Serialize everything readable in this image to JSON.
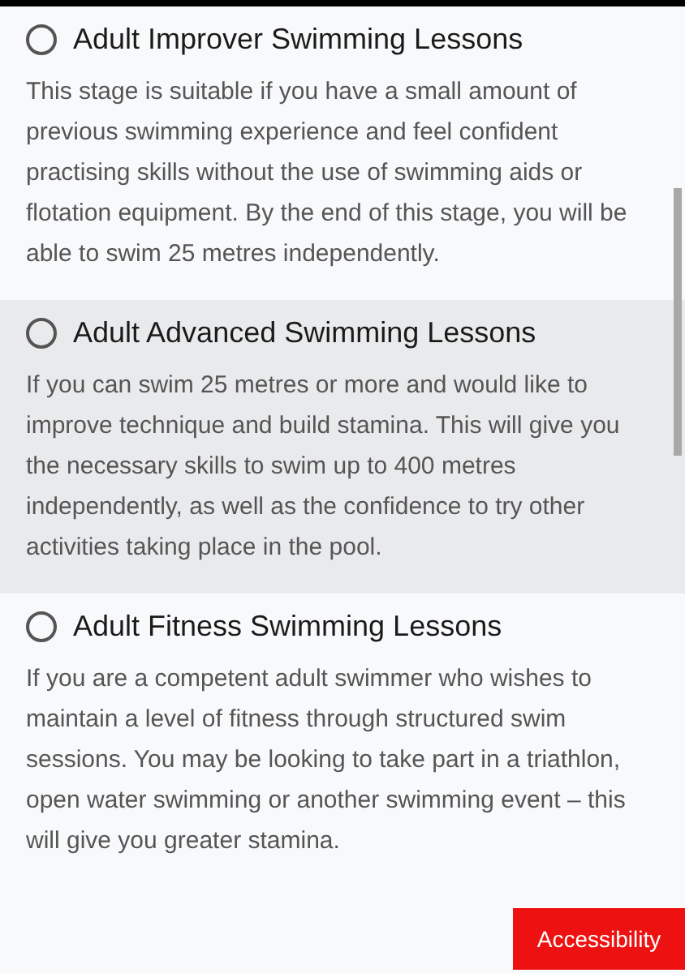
{
  "options": [
    {
      "title": "Adult Improver Swimming Lessons",
      "description": "This stage is suitable if you have a small amount of previous swimming experience and feel confident practising skills without the use of swimming aids or flotation equipment. By the end of this stage, you will be able to swim 25 metres independently.",
      "selected": false,
      "hovered": false
    },
    {
      "title": "Adult Advanced Swimming Lessons",
      "description": "If you can swim 25 metres or more and would like to improve technique and build stamina. This will give you the necessary skills to swim up to 400 metres independently, as well as the confidence to try other activities taking place in the pool.",
      "selected": false,
      "hovered": true
    },
    {
      "title": "Adult Fitness Swimming Lessons",
      "description": "If you are a competent adult swimmer who wishes to maintain a level of fitness through structured swim sessions. You may be looking to take part in a triathlon, open water swimming or another swimming event – this will give you greater stamina.",
      "selected": false,
      "hovered": false
    }
  ],
  "accessibility_button": "Accessibility"
}
